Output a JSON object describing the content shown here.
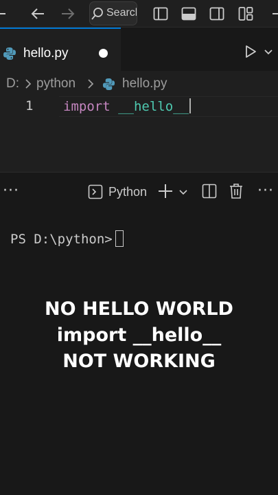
{
  "titlebar": {
    "search_label": "Search",
    "icons": [
      "back-arrow-icon",
      "forward-arrow-icon",
      "search-icon",
      "toggle-primary-sidebar-icon",
      "toggle-panel-icon",
      "toggle-secondary-sidebar-icon",
      "customize-layout-icon"
    ]
  },
  "tab": {
    "label": "hello.py",
    "unsaved": true,
    "icon": "python-file-icon"
  },
  "breadcrumb": {
    "drive": "D:",
    "folder": "python",
    "file": "hello.py"
  },
  "editor": {
    "lines": [
      {
        "number": "1",
        "keyword": "import",
        "identifier": "__hello__"
      }
    ]
  },
  "panel": {
    "terminal_label": "Python",
    "more": "···",
    "icons": [
      "terminal-icon",
      "new-terminal-icon",
      "chevron-down-icon",
      "split-terminal-icon",
      "trash-icon",
      "more-actions-icon"
    ]
  },
  "terminal": {
    "prompt": "PS D:\\python>"
  },
  "caption": {
    "line1": "NO HELLO WORLD",
    "line2": "import __hello__",
    "line3": "NOT WORKING"
  },
  "colors": {
    "accent": "#0078d4",
    "keyword": "#c586c0",
    "identifier": "#4ec9b0",
    "editor_bg": "#1f1f1f",
    "panel_bg": "#181818"
  }
}
